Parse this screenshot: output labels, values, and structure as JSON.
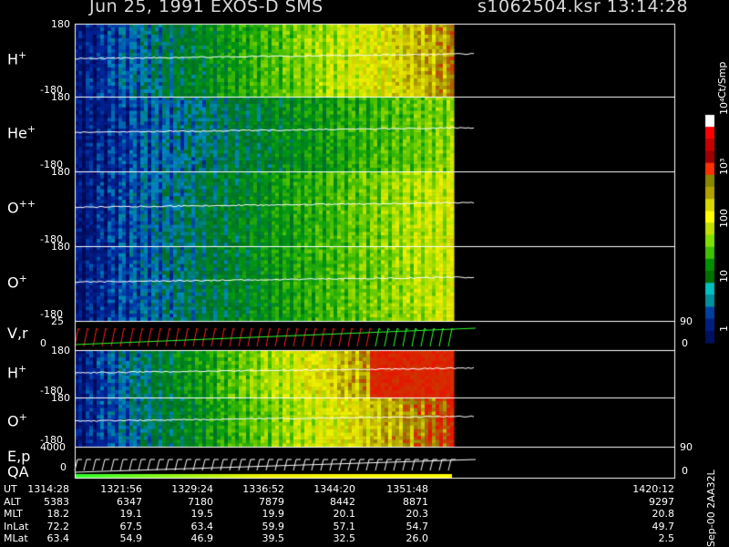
{
  "header": {
    "title_left": "Jun 25, 1991    EXOS-D SMS",
    "title_right": "s1062504.ksr  13:14:28"
  },
  "chart_data": {
    "type": "heatmap",
    "panels": [
      {
        "label": "H",
        "charge": "+",
        "ymax": "180",
        "ymin": "-180",
        "brightness": 0.9
      },
      {
        "label": "He",
        "charge": "+",
        "ymax": "180",
        "ymin": "-180",
        "brightness": 0.6
      },
      {
        "label": "O",
        "charge": "++",
        "ymax": "180",
        "ymin": "-180",
        "brightness": 0.7
      },
      {
        "label": "O",
        "charge": "+",
        "ymax": "180",
        "ymin": "-180",
        "brightness": 0.7
      },
      {
        "label": "V,r",
        "charge": "",
        "ymax": "25",
        "ymin": "0",
        "right_ticks": [
          "90",
          "0"
        ]
      },
      {
        "label": "H",
        "charge": "+",
        "ymax": "180",
        "ymin": "-180",
        "brightness": 1.1
      },
      {
        "label": "O",
        "charge": "+",
        "ymax": "180",
        "ymin": "-180",
        "brightness": 1.0
      },
      {
        "label": "E,p",
        "label2": "QA",
        "ymax": "4000",
        "ymin": "0",
        "right_ticks": [
          "90",
          "0"
        ]
      }
    ],
    "colorbar": {
      "unit": "Ct/Smp",
      "labels": [
        "10⁴",
        "10³",
        "100",
        "10",
        "1"
      ],
      "colors": [
        "#ffffff",
        "#ff0000",
        "#c80000",
        "#a00000",
        "#ff3000",
        "#888800",
        "#b0a000",
        "#d8d800",
        "#ffff00",
        "#c0e000",
        "#80e000",
        "#40c000",
        "#009000",
        "#007000",
        "#00c0c0",
        "#0090a0",
        "#0040a0",
        "#002080",
        "#001060"
      ]
    }
  },
  "table": {
    "rows": [
      {
        "name": "UT",
        "values": [
          "1314:28",
          "1321:56",
          "1329:24",
          "1336:52",
          "1344:20",
          "1351:48",
          "1420:12"
        ]
      },
      {
        "name": "ALT",
        "values": [
          "5383",
          "6347",
          "7180",
          "7879",
          "8442",
          "8871",
          "9297"
        ]
      },
      {
        "name": "MLT",
        "values": [
          "18.2",
          "19.1",
          "19.5",
          "19.9",
          "20.1",
          "20.3",
          "20.8"
        ]
      },
      {
        "name": "InLat",
        "values": [
          "72.2",
          "67.5",
          "63.4",
          "59.9",
          "57.1",
          "54.7",
          "49.7"
        ]
      },
      {
        "name": "MLat",
        "values": [
          "63.4",
          "54.9",
          "46.9",
          "39.5",
          "32.5",
          "26.0",
          "2.5"
        ]
      }
    ]
  },
  "footer": "Sep-00  2AA32L"
}
